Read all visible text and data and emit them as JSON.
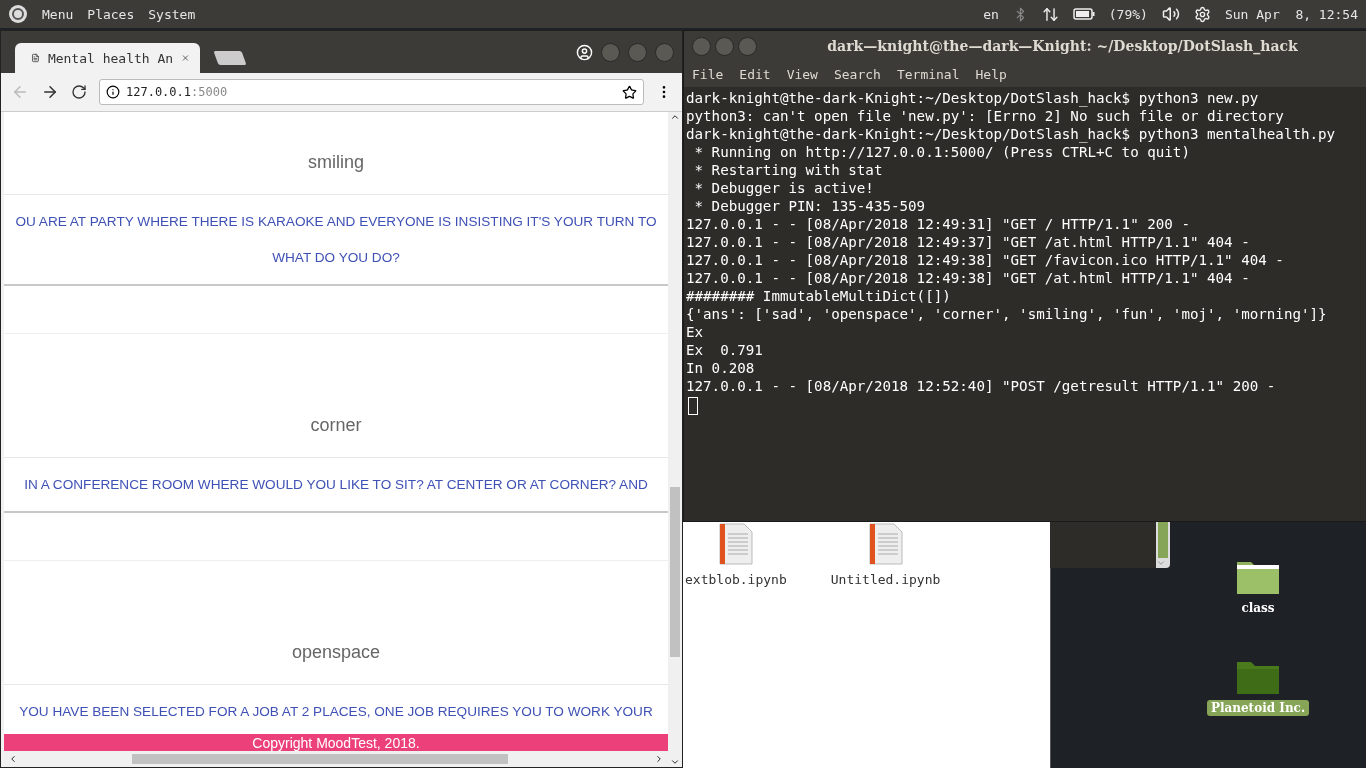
{
  "panel": {
    "menus": [
      "Menu",
      "Places",
      "System"
    ],
    "keyboard": "en",
    "battery": "(79%)",
    "clock": "Sun Apr  8, 12:54"
  },
  "browser": {
    "tabs": [
      {
        "title": "Mental health An",
        "selected": true
      }
    ],
    "url_host": "127.0.0.1",
    "url_port": ":5000",
    "sections": [
      {
        "answer": "smiling",
        "question_lines": [
          "OU ARE AT PARTY WHERE THERE IS KARAOKE AND EVERYONE IS INSISTING IT'S YOUR TURN TO",
          "WHAT DO YOU DO?"
        ]
      },
      {
        "answer": "corner",
        "question_lines": [
          "IN A CONFERENCE ROOM WHERE WOULD YOU LIKE TO SIT? AT CENTER OR AT CORNER? AND"
        ]
      },
      {
        "answer": "openspace",
        "question_lines": [
          "YOU HAVE BEEN SELECTED FOR A JOB AT 2 PLACES, ONE JOB REQUIRES YOU TO WORK YOUR"
        ]
      }
    ],
    "footer": "Copyright MoodTest, 2018."
  },
  "terminal": {
    "title": "dark—knight@the—dark—Knight: ~/Desktop/DotSlash_hack",
    "menus": [
      "File",
      "Edit",
      "View",
      "Search",
      "Terminal",
      "Help"
    ],
    "lines": [
      "dark-knight@the-dark-Knight:~/Desktop/DotSlash_hack$ python3 new.py",
      "python3: can't open file 'new.py': [Errno 2] No such file or directory",
      "dark-knight@the-dark-Knight:~/Desktop/DotSlash_hack$ python3 mentalhealth.py",
      " * Running on http://127.0.0.1:5000/ (Press CTRL+C to quit)",
      " * Restarting with stat",
      " * Debugger is active!",
      " * Debugger PIN: 135-435-509",
      "127.0.0.1 - - [08/Apr/2018 12:49:31] \"GET / HTTP/1.1\" 200 -",
      "127.0.0.1 - - [08/Apr/2018 12:49:37] \"GET /at.html HTTP/1.1\" 404 -",
      "127.0.0.1 - - [08/Apr/2018 12:49:38] \"GET /favicon.ico HTTP/1.1\" 404 -",
      "127.0.0.1 - - [08/Apr/2018 12:49:38] \"GET /at.html HTTP/1.1\" 404 -",
      "######## ImmutableMultiDict([])",
      "{'ans': ['sad', 'openspace', 'corner', 'smiling', 'fun', 'moj', 'morning']}",
      "Ex",
      "Ex  0.791",
      "In 0.208",
      "127.0.0.1 - - [08/Apr/2018 12:52:40] \"POST /getresult HTTP/1.1\" 200 -"
    ]
  },
  "file_manager": {
    "files": [
      "extblob.ipynb",
      "Untitled.ipynb"
    ]
  },
  "desktop": {
    "icons": [
      {
        "label": "class",
        "selected": false
      },
      {
        "label": "Planetoid Inc.",
        "selected": true
      }
    ]
  }
}
